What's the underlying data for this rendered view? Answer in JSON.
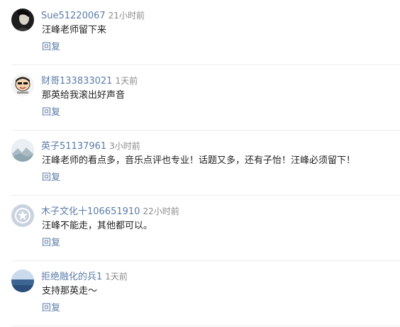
{
  "comments": [
    {
      "username": "Sue51220067",
      "time": "21小时前",
      "text": "汪峰老师留下来",
      "reply_label": "回复",
      "avatar_icon": "portrait-dark-avatar"
    },
    {
      "username": "财哥133833021",
      "time": "1天前",
      "text": "那英给我滚出好声音",
      "reply_label": "回复",
      "avatar_icon": "cartoon-face-avatar"
    },
    {
      "username": "英子51137961",
      "time": "3小时前",
      "text": "汪峰老师的看点多，音乐点评也专业！话题又多，还有子怡！汪峰必须留下！",
      "reply_label": "回复",
      "avatar_icon": "landscape-avatar"
    },
    {
      "username": "木子文化十106651910",
      "time": "22小时前",
      "text": "汪峰不能走，其他都可以。",
      "reply_label": "回复",
      "avatar_icon": "default-star-avatar"
    },
    {
      "username": "拒绝融化的兵1",
      "time": "1天前",
      "text": "支持那英走～",
      "reply_label": "回复",
      "avatar_icon": "sea-horizon-avatar"
    }
  ],
  "colors": {
    "username": "#5b7ca8",
    "time": "#8a8a8a",
    "text": "#222222",
    "reply": "#5b7ca8",
    "divider": "#ececec"
  }
}
